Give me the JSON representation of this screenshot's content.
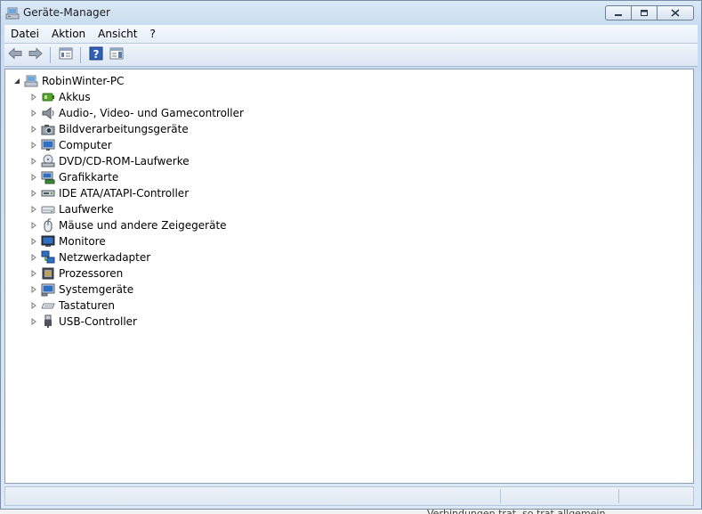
{
  "window": {
    "title": "Geräte-Manager",
    "controls": {
      "minimize_icon": "minimize-icon",
      "maximize_icon": "restore-icon",
      "close_icon": "close-icon"
    }
  },
  "menu": {
    "items": [
      "Datei",
      "Aktion",
      "Ansicht",
      "?"
    ]
  },
  "toolbar": {
    "buttons": [
      "back-arrow-icon",
      "forward-arrow-icon",
      "properties-icon",
      "help-icon",
      "console-tree-icon"
    ]
  },
  "tree": {
    "root": {
      "label": "RobinWinter-PC",
      "icon": "computer-icon",
      "expanded": true
    },
    "items": [
      {
        "label": "Akkus",
        "icon": "battery-icon"
      },
      {
        "label": "Audio-, Video- und Gamecontroller",
        "icon": "speaker-icon"
      },
      {
        "label": "Bildverarbeitungsgeräte",
        "icon": "camera-icon"
      },
      {
        "label": "Computer",
        "icon": "computer-icon"
      },
      {
        "label": "DVD/CD-ROM-Laufwerke",
        "icon": "dvd-drive-icon"
      },
      {
        "label": "Grafikkarte",
        "icon": "display-adapter-icon"
      },
      {
        "label": "IDE ATA/ATAPI-Controller",
        "icon": "ide-controller-icon"
      },
      {
        "label": "Laufwerke",
        "icon": "disk-drive-icon"
      },
      {
        "label": "Mäuse und andere Zeigegeräte",
        "icon": "mouse-icon"
      },
      {
        "label": "Monitore",
        "icon": "monitor-icon"
      },
      {
        "label": "Netzwerkadapter",
        "icon": "network-adapter-icon"
      },
      {
        "label": "Prozessoren",
        "icon": "processor-icon"
      },
      {
        "label": "Systemgeräte",
        "icon": "system-devices-icon"
      },
      {
        "label": "Tastaturen",
        "icon": "keyboard-icon"
      },
      {
        "label": "USB-Controller",
        "icon": "usb-icon"
      }
    ]
  },
  "statusbar": {
    "text": ""
  },
  "background_text": "Verbindungen trat, so trat allgemein"
}
